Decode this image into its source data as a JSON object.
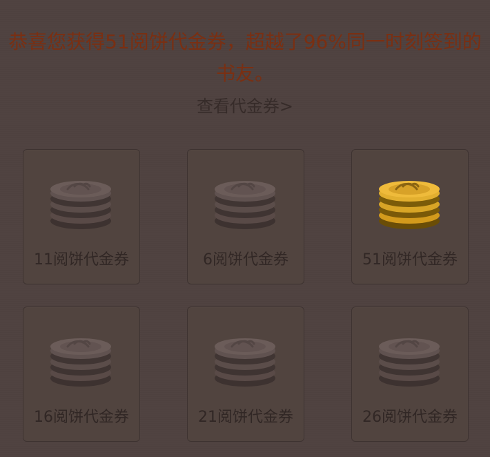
{
  "reward": {
    "message": "恭喜您获得51阅饼代金券，超越了96%同一时刻签到的书友。",
    "link_label": "查看代金券>"
  },
  "cards": [
    {
      "label": "11阅饼代金券",
      "selected": false
    },
    {
      "label": "6阅饼代金券",
      "selected": false
    },
    {
      "label": "51阅饼代金券",
      "selected": true
    },
    {
      "label": "16阅饼代金券",
      "selected": false
    },
    {
      "label": "21阅饼代金券",
      "selected": false
    },
    {
      "label": "26阅饼代金券",
      "selected": false
    }
  ],
  "icons": {
    "coin": "coin-stack-icon"
  },
  "colors": {
    "background": "#504341",
    "headline": "#7a2f12",
    "selected_coin": "#d39a1c"
  }
}
